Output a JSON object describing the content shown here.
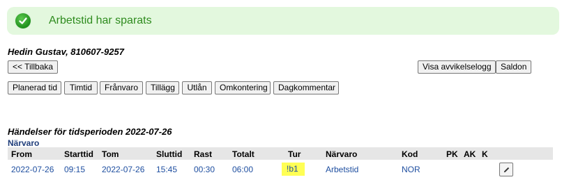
{
  "banner": {
    "message": "Arbetstid har sparats",
    "icon": "check-circle-icon",
    "color": "#2e8b1e"
  },
  "employee": {
    "name_and_id": "Hedin Gustav, 810607-9257"
  },
  "buttons": {
    "back": "<< Tillbaka",
    "deviation_log": "Visa avvikelselogg",
    "balances": "Saldon",
    "planned_time": "Planerad tid",
    "hourly_time": "Timtid",
    "absence": "Frånvaro",
    "addition": "Tillägg",
    "lending": "Utlån",
    "recoding": "Omkontering",
    "day_comment": "Dagkommentar"
  },
  "events": {
    "title": "Händelser för tidsperioden 2022-07-26",
    "group_label": "Närvaro",
    "headers": {
      "from": "From",
      "start_time": "Starttid",
      "to": "Tom",
      "end_time": "Sluttid",
      "break": "Rast",
      "total": "Totalt",
      "shift": "Tur",
      "presence": "Närvaro",
      "code": "Kod",
      "pk": "PK",
      "ak": "AK",
      "k": "K"
    },
    "rows": [
      {
        "from": "2022-07-26",
        "start_time": "09:15",
        "to": "2022-07-26",
        "end_time": "15:45",
        "break": "00:30",
        "total": "06:00",
        "shift": "!b1",
        "presence": "Arbetstid",
        "code": "NOR",
        "edit_icon": "pencil-icon"
      }
    ]
  }
}
